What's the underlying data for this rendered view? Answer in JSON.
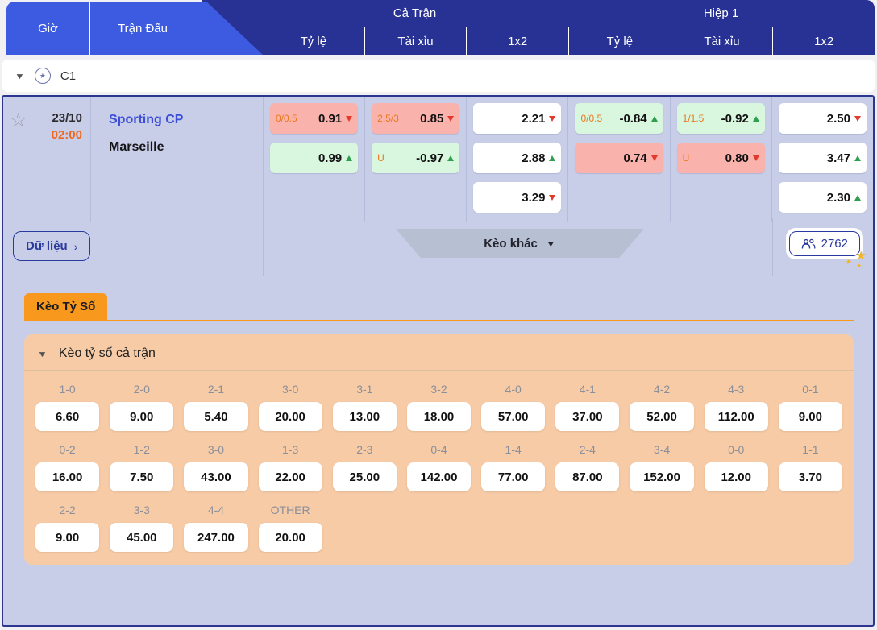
{
  "colors": {
    "accent_blue": "#3d5be0",
    "header_navy": "#283295",
    "row_lavender": "#c9cee8",
    "odds_drop_bg": "#f9b2ac",
    "odds_rise_bg": "#d9f6df",
    "trend_up_green": "#2f9e4e",
    "trend_down_red": "#e23b2e",
    "line_label_orange": "#e87a1e",
    "time_orange": "#f2661c",
    "tab_orange": "#f8991d",
    "panel_peach": "#f6cba6",
    "link_navy": "#2b3a9e",
    "sparkle_gold": "#f5b31a"
  },
  "header": {
    "tabs": [
      {
        "label": "Giờ"
      },
      {
        "label": "Trận Đấu"
      }
    ],
    "groups": [
      {
        "label": "Cả Trận",
        "cols": [
          "Tỷ lệ",
          "Tài xỉu",
          "1x2"
        ]
      },
      {
        "label": "Hiệp 1",
        "cols": [
          "Tỷ lệ",
          "Tài xỉu",
          "1x2"
        ]
      }
    ]
  },
  "league": {
    "name": "C1",
    "logo": "champions-league-logo"
  },
  "match": {
    "date": "23/10",
    "time": "02:00",
    "home": "Sporting CP",
    "away": "Marseille",
    "full": {
      "handicap": [
        {
          "label": "0/0.5",
          "value": "0.91",
          "trend": "down",
          "bg": "red"
        },
        {
          "label": "",
          "value": "0.99",
          "trend": "up",
          "bg": "green"
        }
      ],
      "total": [
        {
          "label": "2.5/3",
          "value": "0.85",
          "trend": "down",
          "bg": "red"
        },
        {
          "label": "U",
          "value": "-0.97",
          "trend": "up",
          "bg": "green"
        }
      ],
      "x12": [
        {
          "value": "2.21",
          "trend": "down"
        },
        {
          "value": "2.88",
          "trend": "up"
        },
        {
          "value": "3.29",
          "trend": "down"
        }
      ]
    },
    "half": {
      "handicap": [
        {
          "label": "0/0.5",
          "value": "-0.84",
          "trend": "up",
          "bg": "green"
        },
        {
          "label": "",
          "value": "0.74",
          "trend": "down",
          "bg": "red"
        }
      ],
      "total": [
        {
          "label": "1/1.5",
          "value": "-0.92",
          "trend": "up",
          "bg": "green"
        },
        {
          "label": "U",
          "value": "0.80",
          "trend": "down",
          "bg": "red"
        }
      ],
      "x12": [
        {
          "value": "2.50",
          "trend": "down"
        },
        {
          "value": "3.47",
          "trend": "up"
        },
        {
          "value": "2.30",
          "trend": "up"
        }
      ]
    },
    "data_button_label": "Dữ liệu",
    "more_odds_label": "Kèo khác",
    "viewers_count": "2762"
  },
  "score_section": {
    "tab_label": "Kèo Tỷ Số",
    "title": "Kèo tỷ số cả trận",
    "rows": [
      [
        {
          "score": "1-0",
          "odds": "6.60"
        },
        {
          "score": "2-0",
          "odds": "9.00"
        },
        {
          "score": "2-1",
          "odds": "5.40"
        },
        {
          "score": "3-0",
          "odds": "20.00"
        },
        {
          "score": "3-1",
          "odds": "13.00"
        },
        {
          "score": "3-2",
          "odds": "18.00"
        },
        {
          "score": "4-0",
          "odds": "57.00"
        },
        {
          "score": "4-1",
          "odds": "37.00"
        },
        {
          "score": "4-2",
          "odds": "52.00"
        },
        {
          "score": "4-3",
          "odds": "112.00"
        },
        {
          "score": "0-1",
          "odds": "9.00"
        }
      ],
      [
        {
          "score": "0-2",
          "odds": "16.00"
        },
        {
          "score": "1-2",
          "odds": "7.50"
        },
        {
          "score": "3-0",
          "odds": "43.00"
        },
        {
          "score": "1-3",
          "odds": "22.00"
        },
        {
          "score": "2-3",
          "odds": "25.00"
        },
        {
          "score": "0-4",
          "odds": "142.00"
        },
        {
          "score": "1-4",
          "odds": "77.00"
        },
        {
          "score": "2-4",
          "odds": "87.00"
        },
        {
          "score": "3-4",
          "odds": "152.00"
        },
        {
          "score": "0-0",
          "odds": "12.00"
        },
        {
          "score": "1-1",
          "odds": "3.70"
        }
      ],
      [
        {
          "score": "2-2",
          "odds": "9.00"
        },
        {
          "score": "3-3",
          "odds": "45.00"
        },
        {
          "score": "4-4",
          "odds": "247.00"
        },
        {
          "score": "OTHER",
          "odds": "20.00"
        }
      ]
    ]
  }
}
